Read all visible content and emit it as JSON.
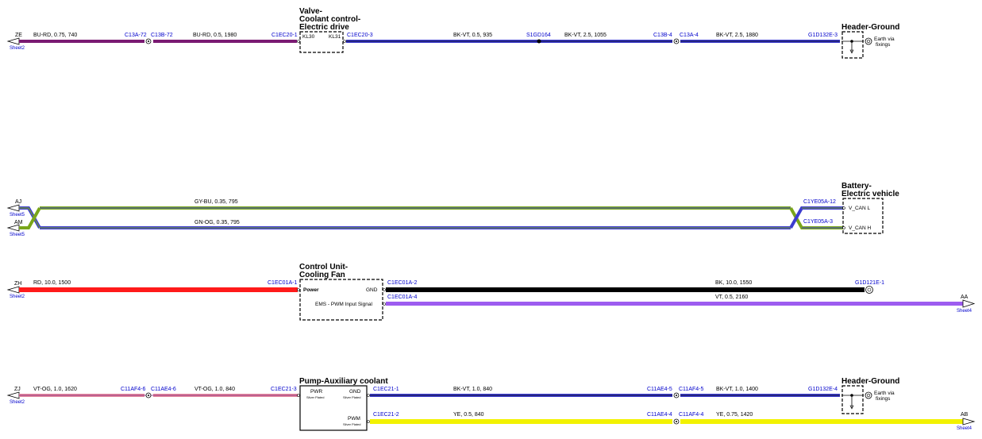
{
  "colors": {
    "purple_wire": "#7a1a72",
    "blue_wire": "#3c3ccf",
    "black_wire": "#000000",
    "green_wire": "#7aa61a",
    "red_wire": "#ff1a1a",
    "violet_wire": "#9d5cf0",
    "pink_wire": "#e58aa0",
    "yellow_wire": "#f2f200",
    "connector_text": "#0000cc"
  },
  "circuits": [
    {
      "offpage_left": {
        "code": "ZE",
        "sheet": "Sheet2"
      },
      "component": {
        "title_lines": [
          "Valve-",
          "Coolant control-",
          "Electric drive"
        ],
        "pins": [
          "KL30",
          "KL31"
        ]
      },
      "wires": [
        "BU-RD, 0.75, 740",
        "BU-RD, 0.5, 1980",
        "BK-VT, 0.5, 935",
        "BK-VT, 2.5, 1055",
        "BK-VT, 2.5, 1880"
      ],
      "connectors": [
        "C13A-72",
        "C13B-72",
        "C1EC20-1",
        "C1EC20-3",
        "S1GD164",
        "C13B-4",
        "C13A-4",
        "G1D132E-3"
      ],
      "ground": {
        "title": "Header-Ground",
        "label_lines": [
          "Earth via",
          "fixings"
        ]
      }
    },
    {
      "offpage_left": [
        {
          "code": "AJ",
          "sheet": "Sheet5"
        },
        {
          "code": "AM",
          "sheet": "Sheet5"
        }
      ],
      "wires": [
        "GY-BU, 0.35, 795",
        "GN-OG, 0.35, 795"
      ],
      "connectors": [
        "C1YE05A-12",
        "C1YE05A-3"
      ],
      "component": {
        "title_lines": [
          "Battery-",
          "Electric vehicle"
        ],
        "pins": [
          "V_CAN L",
          "V_CAN H"
        ]
      }
    },
    {
      "offpage_left": {
        "code": "ZH",
        "sheet": "Sheet2"
      },
      "offpage_right": {
        "code": "AA",
        "sheet": "Sheet4"
      },
      "component": {
        "title_lines": [
          "Control Unit-",
          "Cooling Fan"
        ],
        "pins": [
          "Power",
          "GND",
          "EMS - PWM Input Signal"
        ]
      },
      "wires": [
        "RD, 10.0, 1500",
        "BK, 10.0, 1550",
        "VT, 0.5, 2160"
      ],
      "connectors": [
        "C1EC01A-1",
        "C1EC01A-2",
        "C1EC01A-4",
        "G1D121E-1"
      ]
    },
    {
      "offpage_left": {
        "code": "ZJ",
        "sheet": "Sheet2"
      },
      "offpage_right": {
        "code": "AB",
        "sheet": "Sheet4"
      },
      "component": {
        "title_lines": [
          "Pump-Auxiliary coolant"
        ],
        "pins": [
          "PWR",
          "GND",
          "PWM"
        ],
        "pin_note": "Silver Plated"
      },
      "wires": [
        "VT-OG, 1.0, 1620",
        "VT-OG, 1.0, 840",
        "BK-VT, 1.0, 840",
        "BK-VT, 1.0, 1400",
        "YE, 0.5, 840",
        "YE, 0.75, 1420"
      ],
      "connectors": [
        "C11AF4-6",
        "C11AE4-6",
        "C1EC21-3",
        "C1EC21-1",
        "C11AE4-5",
        "C11AF4-5",
        "G1D132E-4",
        "C1EC21-2",
        "C11AE4-4",
        "C11AF4-4"
      ],
      "ground": {
        "title": "Header-Ground",
        "label_lines": [
          "Earth via",
          "fixings"
        ]
      }
    }
  ]
}
